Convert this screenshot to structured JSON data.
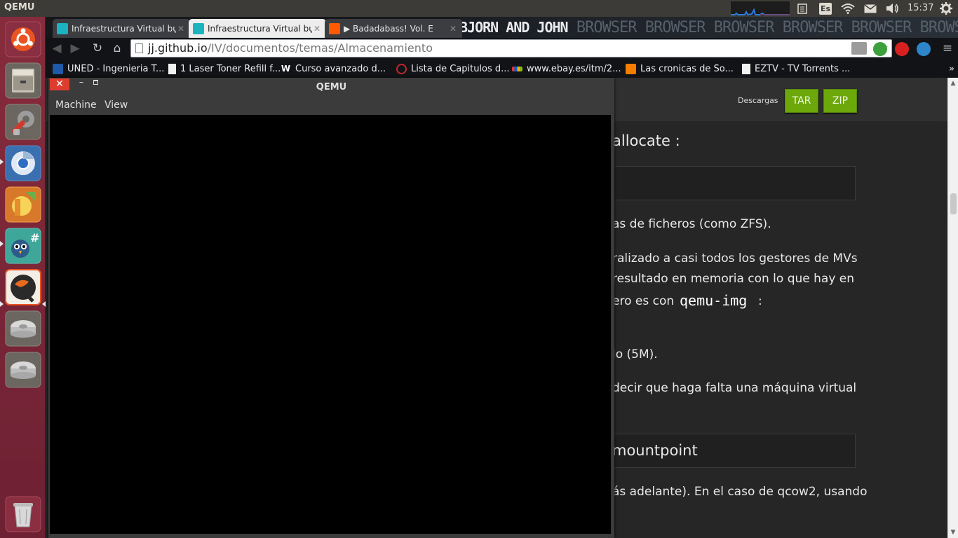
{
  "top_panel": {
    "app_title": "QEMU",
    "keyboard_layout": "Es",
    "clock": "15:37",
    "icons": [
      "network-graph-icon",
      "clipboard-icon",
      "keyboard-layout-icon",
      "wifi-icon",
      "mail-icon",
      "volume-icon",
      "power-gear-icon"
    ]
  },
  "launcher": {
    "items": [
      {
        "name": "ubuntu-dash-icon"
      },
      {
        "name": "file-cabinet-icon"
      },
      {
        "name": "system-settings-icon"
      },
      {
        "name": "chromium-icon"
      },
      {
        "name": "eclipse-editor-icon"
      },
      {
        "name": "hashtag-bird-icon"
      },
      {
        "name": "qemu-icon"
      },
      {
        "name": "drive-icon"
      },
      {
        "name": "drive-icon"
      },
      {
        "name": "trash-icon"
      }
    ]
  },
  "chrome": {
    "tabs": [
      {
        "title": "Infraestructura Virtual bụ",
        "favicon_color": "#1bb3c0",
        "active": false
      },
      {
        "title": "Infraestructura Virtual bụ",
        "favicon_color": "#1bb3c0",
        "active": true
      },
      {
        "title": "▶ Badadabass! Vol. E",
        "favicon_color": "#ff5a00",
        "active": false
      }
    ],
    "banner": {
      "bold": "BJORN AND JOHN",
      "faint": "BROWSER BROWSER BROWSER BROWSER BROWSER BROWSER"
    },
    "address": {
      "host": "jj.github.io",
      "path": "/IV/documentos/temas/Almacenamiento"
    },
    "bookmarks": [
      {
        "label": "UNED - Ingenieria T...",
        "icon_color": "#1e5aa8"
      },
      {
        "label": "1 Laser Toner Refill f...",
        "icon_color": "#f2f2f2"
      },
      {
        "label": "Curso avanzado d...",
        "icon_color": "#111317"
      },
      {
        "label": "Lista de Capitulos d...",
        "icon_color": "#c0282d"
      },
      {
        "label": "www.ebay.es/itm/2...",
        "icon_color": "#e53238"
      },
      {
        "label": "Las cronicas de So...",
        "icon_color": "#f57d00"
      },
      {
        "label": "EZTV - TV Torrents ...",
        "icon_color": "#f2f2f2"
      }
    ],
    "more_bookmarks": "»"
  },
  "page": {
    "downloads_label": "Descargas",
    "tar_label": "TAR",
    "zip_label": "ZIP",
    "lines": {
      "heading_allocate": "allocate :",
      "text_1": "as de ficheros (como ZFS).",
      "text_2": "ralizado a casi todos los gestores de MVs",
      "text_3": "resultado en memoria con lo que hay en",
      "text_4a": "ero es con",
      "text_4b": "qemu-img",
      "text_4c": ":",
      "text_5": "lo (5M).",
      "text_6": "decir que haga falta una máquina virtual",
      "heading_mountpoint": "mountpoint",
      "text_7": "ás adelante). En el caso de qcow2, usando"
    }
  },
  "qemu": {
    "title": "QEMU",
    "close_glyph": "✕",
    "minimize_glyph": "–",
    "menu": {
      "machine": "Machine",
      "view": "View"
    }
  }
}
